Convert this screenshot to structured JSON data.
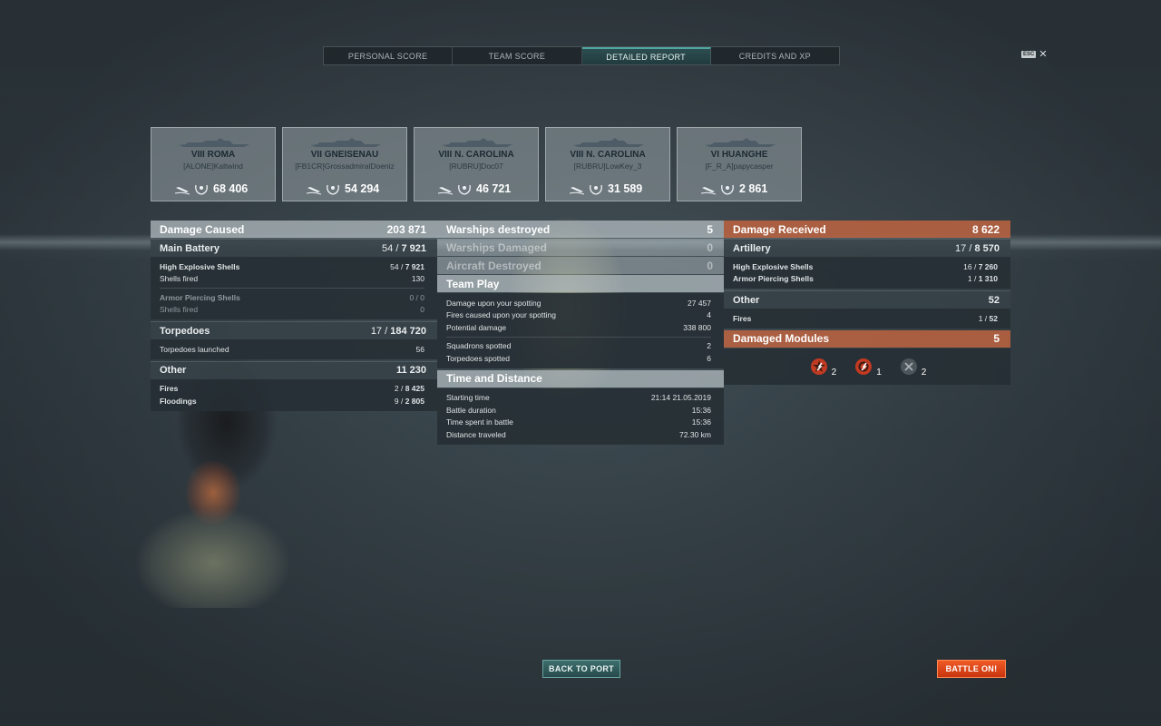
{
  "tabs": [
    {
      "label": "PERSONAL SCORE",
      "active": false
    },
    {
      "label": "TEAM SCORE",
      "active": false
    },
    {
      "label": "DETAILED REPORT",
      "active": true
    },
    {
      "label": "CREDITS AND XP",
      "active": false
    }
  ],
  "esc": {
    "key": "ESC",
    "close": "✕"
  },
  "cards": [
    {
      "ship": "VIII ROMA",
      "player": "[ALONE]Kaltwind",
      "score": "68 406"
    },
    {
      "ship": "VII GNEISENAU",
      "player": "[FB1CR]GrossadmiralDoeniz",
      "score": "54 294"
    },
    {
      "ship": "VIII N. CAROLINA",
      "player": "[RUBRU]Doc07",
      "score": "46 721"
    },
    {
      "ship": "VIII N. CAROLINA",
      "player": "[RUBRU]LowKey_3",
      "score": "31 589"
    },
    {
      "ship": "VI HUANGHE",
      "player": "[F_R_A]papycasper",
      "score": "2 861"
    }
  ],
  "left": {
    "damage_caused": {
      "label": "Damage Caused",
      "value": "203 871"
    },
    "main_battery": {
      "label": "Main Battery",
      "hits": "54",
      "slash": " / ",
      "damage": "7 921"
    },
    "he": {
      "label": "High Explosive Shells",
      "hits": "54",
      "slash": " / ",
      "damage": "7 921"
    },
    "he_fired": {
      "label": "Shells fired",
      "value": "130"
    },
    "ap": {
      "label": "Armor Piercing Shells",
      "hits": "0",
      "slash": " / ",
      "damage": "0"
    },
    "ap_fired": {
      "label": "Shells fired",
      "value": "0"
    },
    "torpedoes": {
      "label": "Torpedoes",
      "hits": "17",
      "slash": " / ",
      "damage": "184 720"
    },
    "torp_launched": {
      "label": "Torpedoes launched",
      "value": "56"
    },
    "other": {
      "label": "Other",
      "value": "11 230"
    },
    "fires": {
      "label": "Fires",
      "hits": "2",
      "slash": " / ",
      "damage": "8 425"
    },
    "floodings": {
      "label": "Floodings",
      "hits": "9",
      "slash": " / ",
      "damage": "2 805"
    }
  },
  "mid": {
    "warships_destroyed": {
      "label": "Warships destroyed",
      "value": "5"
    },
    "warships_damaged": {
      "label": "Warships Damaged",
      "value": "0"
    },
    "aircraft_destroyed": {
      "label": "Aircraft Destroyed",
      "value": "0"
    },
    "team_play": {
      "label": "Team Play"
    },
    "spot_damage": {
      "label": "Damage upon your spotting",
      "value": "27 457"
    },
    "spot_fires": {
      "label": "Fires caused upon your spotting",
      "value": "4"
    },
    "potential": {
      "label": "Potential damage",
      "value": "338 800"
    },
    "squadrons": {
      "label": "Squadrons spotted",
      "value": "2"
    },
    "torps_spotted": {
      "label": "Torpedoes spotted",
      "value": "6"
    },
    "time_distance": {
      "label": "Time and Distance"
    },
    "start": {
      "label": "Starting time",
      "value": "21:14  21.05.2019"
    },
    "duration": {
      "label": "Battle duration",
      "value": "15:36"
    },
    "time_spent": {
      "label": "Time spent in battle",
      "value": "15:36"
    },
    "distance": {
      "label": "Distance traveled",
      "value": "72.30 km"
    }
  },
  "right": {
    "damage_received": {
      "label": "Damage Received",
      "value": "8 622"
    },
    "artillery": {
      "label": "Artillery",
      "hits": "17",
      "slash": " / ",
      "damage": "8 570"
    },
    "he": {
      "label": "High Explosive Shells",
      "hits": "16",
      "slash": " / ",
      "damage": "7 260"
    },
    "ap": {
      "label": "Armor Piercing Shells",
      "hits": "1",
      "slash": " / ",
      "damage": "1 310"
    },
    "other": {
      "label": "Other",
      "value": "52"
    },
    "fires": {
      "label": "Fires",
      "hits": "1",
      "slash": " / ",
      "damage": "52"
    },
    "damaged_modules": {
      "label": "Damaged Modules",
      "value": "5"
    },
    "modules": [
      {
        "icon": "engine-damaged-icon",
        "count": "2",
        "color": "#c23a22"
      },
      {
        "icon": "steering-damaged-icon",
        "count": "1",
        "color": "#c23a22"
      },
      {
        "icon": "module-destroyed-icon",
        "count": "2",
        "color": "#4b555a"
      }
    ]
  },
  "buttons": {
    "back": "BACK TO PORT",
    "battle": "BATTLE ON!"
  }
}
